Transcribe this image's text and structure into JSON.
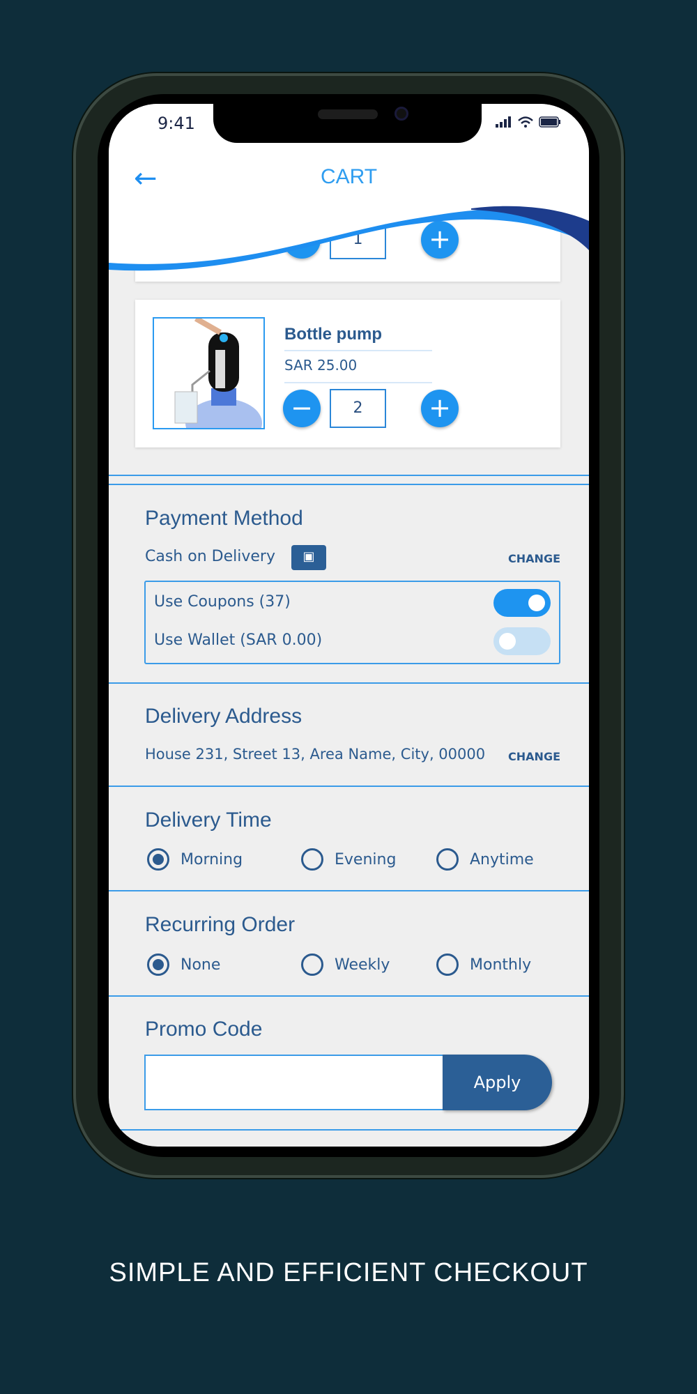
{
  "status_bar": {
    "time": "9:41"
  },
  "header": {
    "title": "CART",
    "back_icon": "arrow-left-icon"
  },
  "cart": {
    "items": [
      {
        "name": "",
        "quantity": "1"
      },
      {
        "name": "Bottle pump",
        "price": "SAR 25.00",
        "quantity": "2"
      }
    ]
  },
  "payment": {
    "heading": "Payment Method",
    "method": "Cash on Delivery",
    "method_icon": "cash-icon",
    "change_label": "CHANGE",
    "coupons_label": "Use Coupons (37)",
    "coupons_on": true,
    "wallet_label": "Use Wallet (SAR 0.00)",
    "wallet_on": false
  },
  "address": {
    "heading": "Delivery Address",
    "value": "House 231, Street 13, Area Name, City, 00000",
    "change_label": "CHANGE"
  },
  "delivery_time": {
    "heading": "Delivery Time",
    "options": [
      "Morning",
      "Evening",
      "Anytime"
    ],
    "selected": "Morning"
  },
  "recurring": {
    "heading": "Recurring Order",
    "options": [
      "None",
      "Weekly",
      "Monthly"
    ],
    "selected": "None"
  },
  "promo": {
    "heading": "Promo Code",
    "value": "",
    "apply_label": "Apply"
  },
  "caption": "SIMPLE AND EFFICIENT CHECKOUT",
  "colors": {
    "background": "#0e2d3a",
    "accent": "#1e94f0",
    "text": "#2b5a8e",
    "apply": "#2b5f96"
  }
}
